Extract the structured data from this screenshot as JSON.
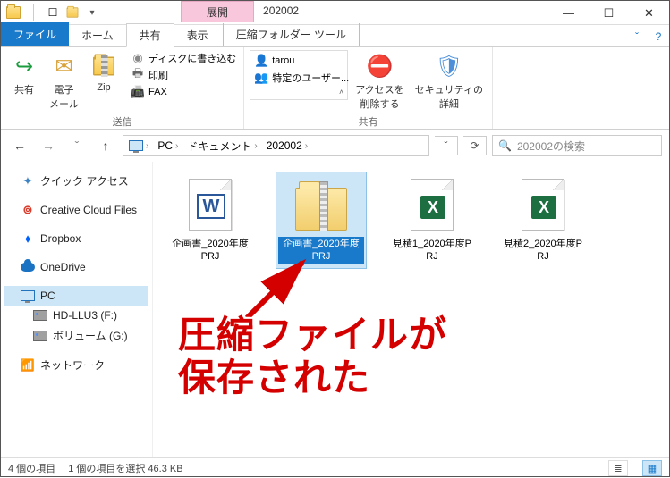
{
  "titlebar": {
    "context_tab": "展開",
    "title": "202002",
    "min": "—",
    "max": "☐",
    "close": "✕"
  },
  "tabs": {
    "file": "ファイル",
    "home": "ホーム",
    "share": "共有",
    "view": "表示",
    "context": "圧縮フォルダー ツール",
    "help": "?",
    "collapse": "ˇ"
  },
  "ribbon": {
    "share_btn": "共有",
    "email_btn": "電子\nメール",
    "zip_btn": "Zip",
    "burn": "ディスクに書き込む",
    "print": "印刷",
    "fax": "FAX",
    "group_send": "送信",
    "user1": "tarou",
    "user2": "特定のユーザー...",
    "access": "アクセスを\n削除する",
    "security": "セキュリティの\n詳細",
    "group_share": "共有"
  },
  "nav": {
    "back": "←",
    "forward": "→",
    "recent": "ˇ",
    "up": "↑"
  },
  "breadcrumb": {
    "pc": "PC",
    "docs": "ドキュメント",
    "folder": "202002",
    "dropdown": "ˇ",
    "refresh": "⟳"
  },
  "search": {
    "icon": "🔍",
    "placeholder": "202002の検索"
  },
  "sidebar": {
    "quick": "クイック アクセス",
    "ccloud": "Creative Cloud Files",
    "dropbox": "Dropbox",
    "onedrive": "OneDrive",
    "pc": "PC",
    "hdd": "HD-LLU3 (F:)",
    "vol": "ボリューム (G:)",
    "network": "ネットワーク"
  },
  "files": [
    {
      "name": "企画書_2020年度PRJ",
      "type": "word"
    },
    {
      "name": "企画書_2020年度PRJ",
      "type": "zip",
      "selected": true
    },
    {
      "name": "見積1_2020年度PRJ",
      "type": "excel"
    },
    {
      "name": "見積2_2020年度PRJ",
      "type": "excel"
    }
  ],
  "annotation": {
    "line1": "圧縮ファイルが",
    "line2": "保存された"
  },
  "status": {
    "count": "4 個の項目",
    "selected": "1 個の項目を選択 46.3 KB"
  }
}
